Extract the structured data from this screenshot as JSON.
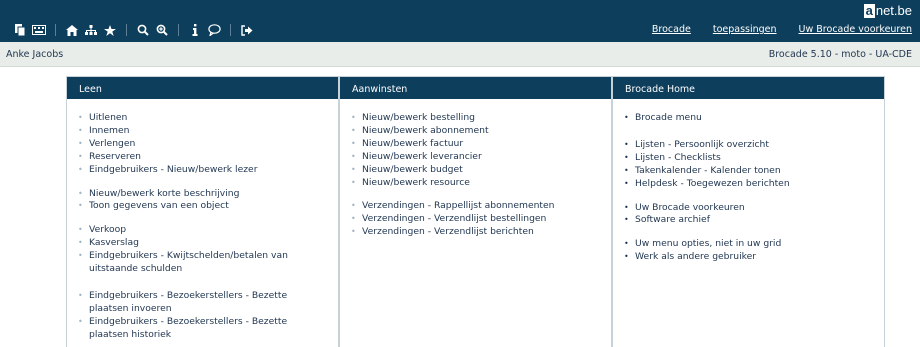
{
  "header": {
    "logo": {
      "box": "a",
      "rest": "net.be"
    },
    "links": [
      "Brocade",
      "toepassingen",
      "Uw Brocade voorkeuren"
    ]
  },
  "subbar": {
    "user": "Anke Jacobs",
    "version": "Brocade 5.10 - moto - UA-CDE"
  },
  "panels": {
    "leen": {
      "title": "Leen",
      "items": [
        "Uitlenen",
        "Innemen",
        "Verlengen",
        "Reserveren",
        "Eindgebruikers - Nieuw/bewerk lezer",
        "Nieuw/bewerk korte beschrijving",
        "Toon gegevens van een object",
        "Verkoop",
        "Kasverslag",
        "Eindgebruikers - Kwijtschelden/betalen van uitstaande schulden",
        "Eindgebruikers - Bezoekerstellers - Bezette plaatsen invoeren",
        "Eindgebruikers - Bezoekerstellers - Bezette plaatsen historiek"
      ]
    },
    "aanwinsten": {
      "title": "Aanwinsten",
      "items": [
        "Nieuw/bewerk bestelling",
        "Nieuw/bewerk abonnement",
        "Nieuw/bewerk factuur",
        "Nieuw/bewerk leverancier",
        "Nieuw/bewerk budget",
        "Nieuw/bewerk resource",
        "Verzendingen - Rappellijst abonnementen",
        "Verzendingen - Verzendlijst bestellingen",
        "Verzendingen - Verzendlijst berichten"
      ]
    },
    "home": {
      "title": "Brocade Home",
      "items": [
        "Brocade menu",
        "Lijsten - Persoonlijk overzicht",
        "Lijsten - Checklists",
        "Takenkalender - Kalender tonen",
        "Helpdesk - Toegewezen berichten",
        "Uw Brocade voorkeuren",
        "Software archief",
        "Uw menu opties, niet in uw grid",
        "Werk als andere gebruiker"
      ]
    }
  }
}
